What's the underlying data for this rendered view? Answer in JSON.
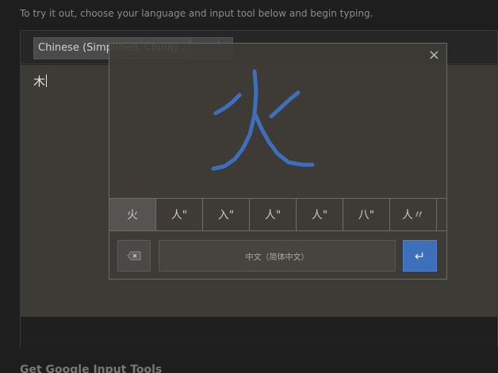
{
  "intro_text": "To try it out, choose your language and input tool below and begin typing.",
  "toolbar": {
    "language": "Chinese (Simplified, China)"
  },
  "editor": {
    "text": "木"
  },
  "handwriting": {
    "candidates": [
      "火",
      "人\"",
      "入\"",
      "人\"",
      "人\"",
      "八\"",
      "人〃"
    ],
    "selected_index": 0,
    "mode_label": "中文（简体中文）",
    "close_symbol": "×",
    "enter_symbol": "↵",
    "stroke_color": "#3e6fba"
  },
  "footer": {
    "heading": "Get Google Input Tools"
  }
}
